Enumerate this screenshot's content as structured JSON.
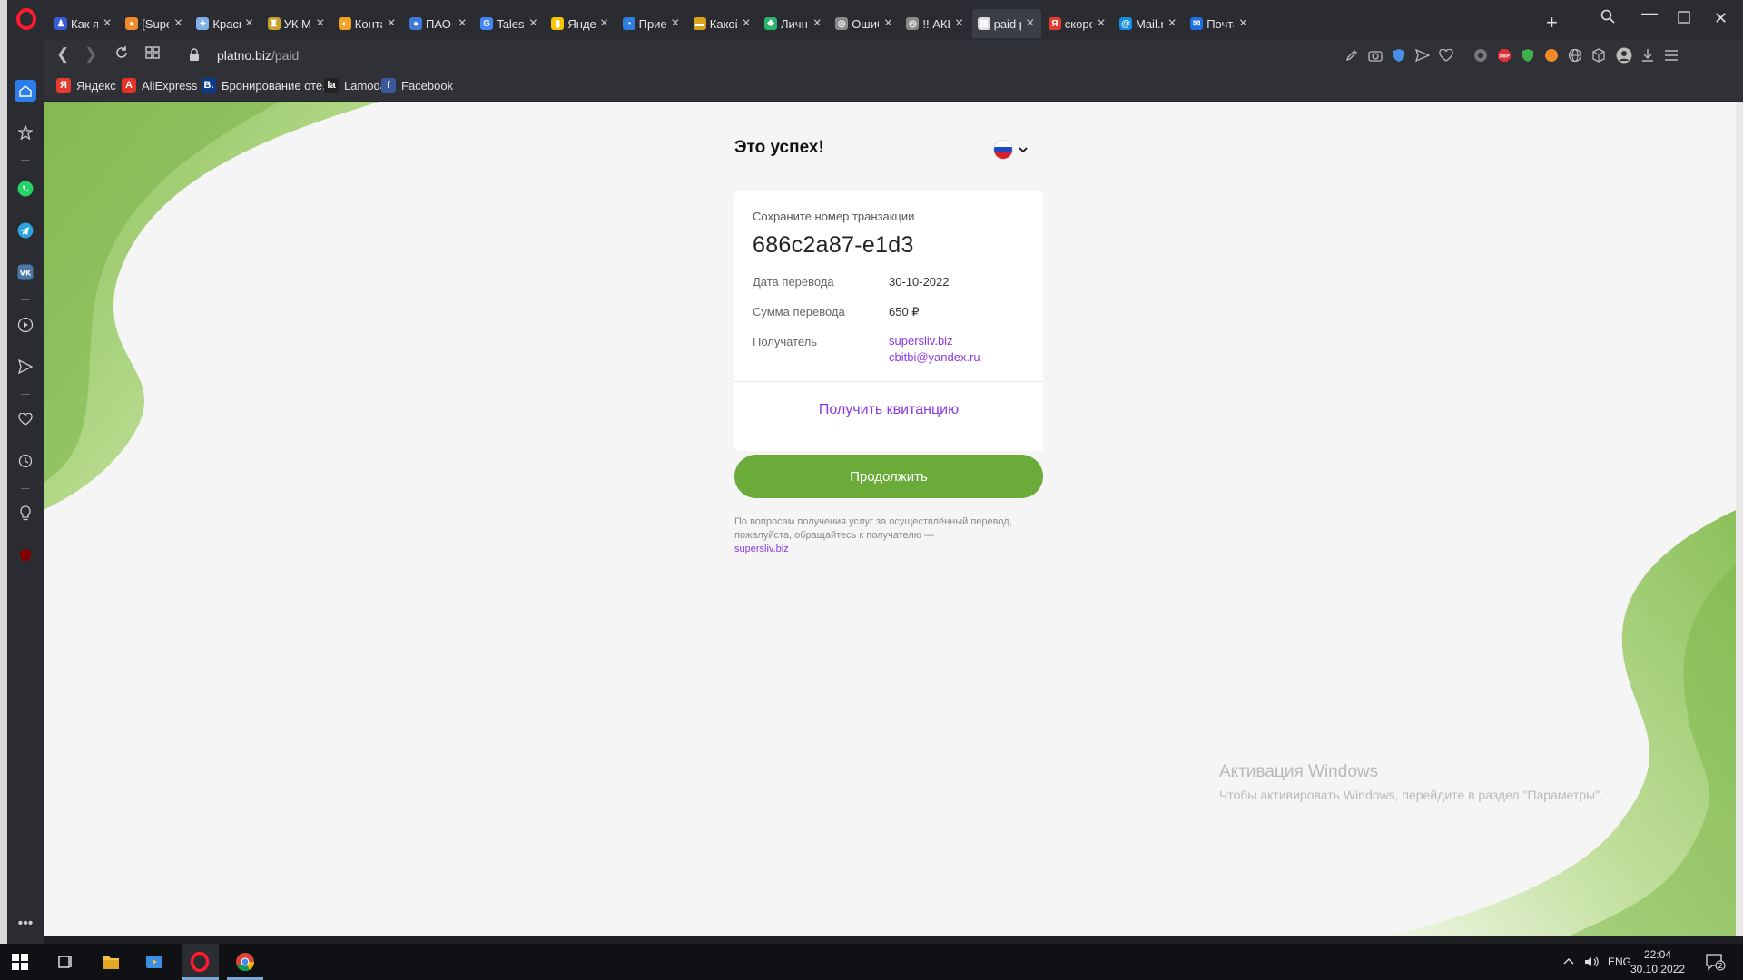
{
  "tabs": [
    {
      "label": "Как я го",
      "color": "#3a5bd8",
      "glyph": "♟"
    },
    {
      "label": "[SuperS",
      "color": "#f08a2a",
      "glyph": "●"
    },
    {
      "label": "Красно",
      "color": "#7fb0e8",
      "glyph": "✦"
    },
    {
      "label": "УК Мер",
      "color": "#c9a12c",
      "glyph": "♜"
    },
    {
      "label": "Контакт",
      "color": "#f2a428",
      "glyph": "◐"
    },
    {
      "label": "ПАО \"К",
      "color": "#3e7ad6",
      "glyph": "●"
    },
    {
      "label": "Tales fro",
      "color": "#4285f4",
      "glyph": "G"
    },
    {
      "label": "Яндекс",
      "color": "#f6c400",
      "glyph": "▮"
    },
    {
      "label": "Прием",
      "color": "#2f7fe0",
      "glyph": "◔"
    },
    {
      "label": "Какой а",
      "color": "#d8a21c",
      "glyph": "▬"
    },
    {
      "label": "Личный",
      "color": "#2ab36b",
      "glyph": "❖"
    },
    {
      "label": "Ошибка",
      "color": "#8a8a8a",
      "glyph": "◎"
    },
    {
      "label": "!! АКЦИ",
      "color": "#8a8a8a",
      "glyph": "◎"
    },
    {
      "label": "paid pay",
      "color": "#dddddd",
      "glyph": "▥"
    },
    {
      "label": "скорост",
      "color": "#e33b2e",
      "glyph": "Я"
    },
    {
      "label": "Mail.ru",
      "color": "#168de2",
      "glyph": "@"
    },
    {
      "label": "Почта М",
      "color": "#1f6fe0",
      "glyph": "✉"
    }
  ],
  "active_tab_index": 13,
  "address": {
    "domain": "platno.biz",
    "path": "/paid"
  },
  "bookmarks": [
    {
      "label": "Яндекс",
      "color": "#e33b2e",
      "glyph": "Я"
    },
    {
      "label": "AliExpress",
      "color": "#e43225",
      "glyph": "A"
    },
    {
      "label": "Бронирование оте...",
      "color": "#0c3b8c",
      "glyph": "B."
    },
    {
      "label": "Lamoda",
      "color": "#222222",
      "glyph": "la"
    },
    {
      "label": "Facebook",
      "color": "#3b5998",
      "glyph": "f"
    }
  ],
  "page": {
    "title": "Это успех!",
    "card": {
      "caption": "Сохраните номер транзакции",
      "transaction_id": "686c2a87-e1d3",
      "date_label": "Дата перевода",
      "date_value": "30-10-2022",
      "amount_label": "Сумма перевода",
      "amount_value": "650 ₽",
      "recipient_label": "Получатель",
      "recipient_site": "supersliv.biz",
      "recipient_email": "cbitbi@yandex.ru",
      "receipt_link": "Получить квитанцию"
    },
    "continue_label": "Продолжить",
    "footnote_text": "По вопросам получения услуг за осуществлённый перевод, пожалуйста, обращайтесь к получателю —",
    "footnote_link": "supersliv.biz"
  },
  "activation": {
    "title": "Активация Windows",
    "subtitle": "Чтобы активировать Windows, перейдите в раздел \"Параметры\"."
  },
  "taskbar": {
    "lang": "ENG",
    "time": "22:04",
    "date": "30.10.2022",
    "notifications": "2"
  },
  "colors": {
    "accent_green": "#6aab3a",
    "link_purple": "#8b3ae0"
  }
}
